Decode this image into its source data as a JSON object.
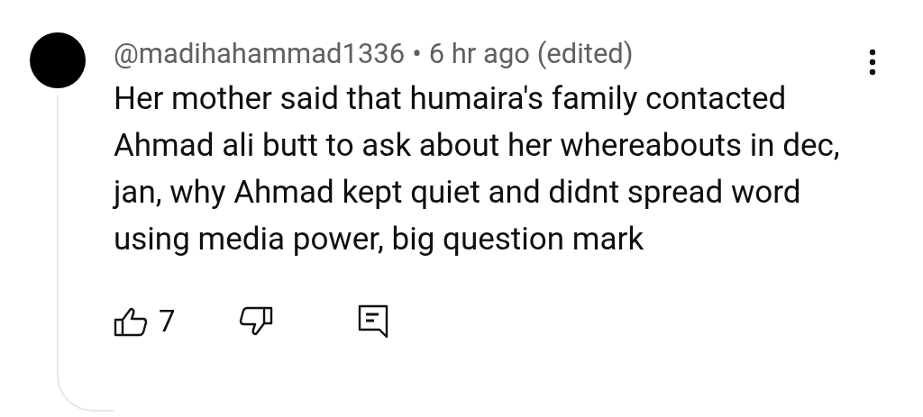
{
  "comment": {
    "author": "@madihahammad1336",
    "separator": "•",
    "time": "6 hr ago (edited)",
    "text": "Her mother said that humaira's family contacted Ahmad ali butt to ask about her whereabouts in dec, jan, why Ahmad kept quiet and didnt spread word using media power, big question mark",
    "likes": "7"
  }
}
